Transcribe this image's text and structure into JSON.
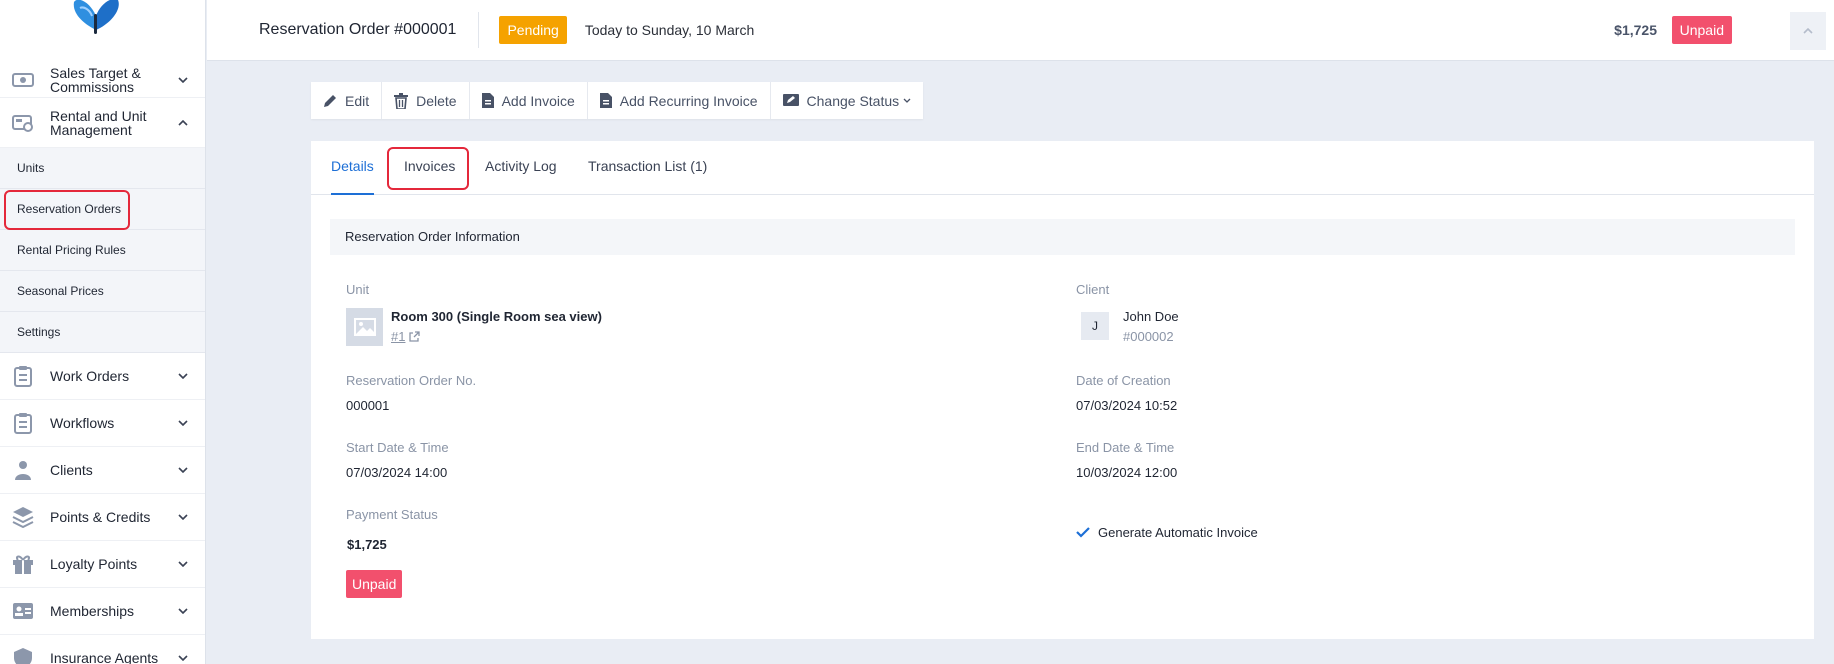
{
  "sidebar": {
    "items_top": [
      {
        "label": "Sales Target & Commissions",
        "icon": "money-icon"
      },
      {
        "label": "Rental and Unit Management",
        "icon": "rental-icon"
      }
    ],
    "sub_items": [
      "Units",
      "Reservation Orders",
      "Rental Pricing Rules",
      "Seasonal Prices",
      "Settings"
    ],
    "items_bottom": [
      {
        "label": "Work Orders",
        "icon": "clipboard-icon"
      },
      {
        "label": "Workflows",
        "icon": "clipboard-icon"
      },
      {
        "label": "Clients",
        "icon": "person-icon"
      },
      {
        "label": "Points & Credits",
        "icon": "layers-icon"
      },
      {
        "label": "Loyalty Points",
        "icon": "gift-icon"
      },
      {
        "label": "Memberships",
        "icon": "id-card-icon"
      },
      {
        "label": "Insurance Agents",
        "icon": "shield-icon"
      }
    ]
  },
  "header": {
    "title": "Reservation Order #000001",
    "status": "Pending",
    "range": "Today to Sunday, 10 March",
    "amount": "$1,725",
    "payment_badge": "Unpaid"
  },
  "toolbar": {
    "edit": "Edit",
    "delete": "Delete",
    "add_invoice": "Add Invoice",
    "add_recurring": "Add Recurring Invoice",
    "change_status": "Change Status"
  },
  "tabs": [
    "Details",
    "Invoices",
    "Activity Log",
    "Transaction List (1)"
  ],
  "details": {
    "section_title": "Reservation Order Information",
    "unit_label": "Unit",
    "unit_name": "Room 300 (Single Room sea view)",
    "unit_link": "#1",
    "client_label": "Client",
    "client_initial": "J",
    "client_name": "John Doe",
    "client_id": "#000002",
    "order_no_label": "Reservation Order No.",
    "order_no": "000001",
    "created_label": "Date of Creation",
    "created": "07/03/2024 10:52",
    "start_label": "Start Date & Time",
    "start": "07/03/2024 14:00",
    "end_label": "End Date & Time",
    "end": "10/03/2024 12:00",
    "payment_label": "Payment Status",
    "payment_amount": "$1,725",
    "payment_status": "Unpaid",
    "auto_invoice": "Generate Automatic Invoice"
  },
  "colors": {
    "accent": "#1d6fd6",
    "pending": "#f5a200",
    "unpaid": "#f2506d",
    "highlight": "#e4283b"
  }
}
